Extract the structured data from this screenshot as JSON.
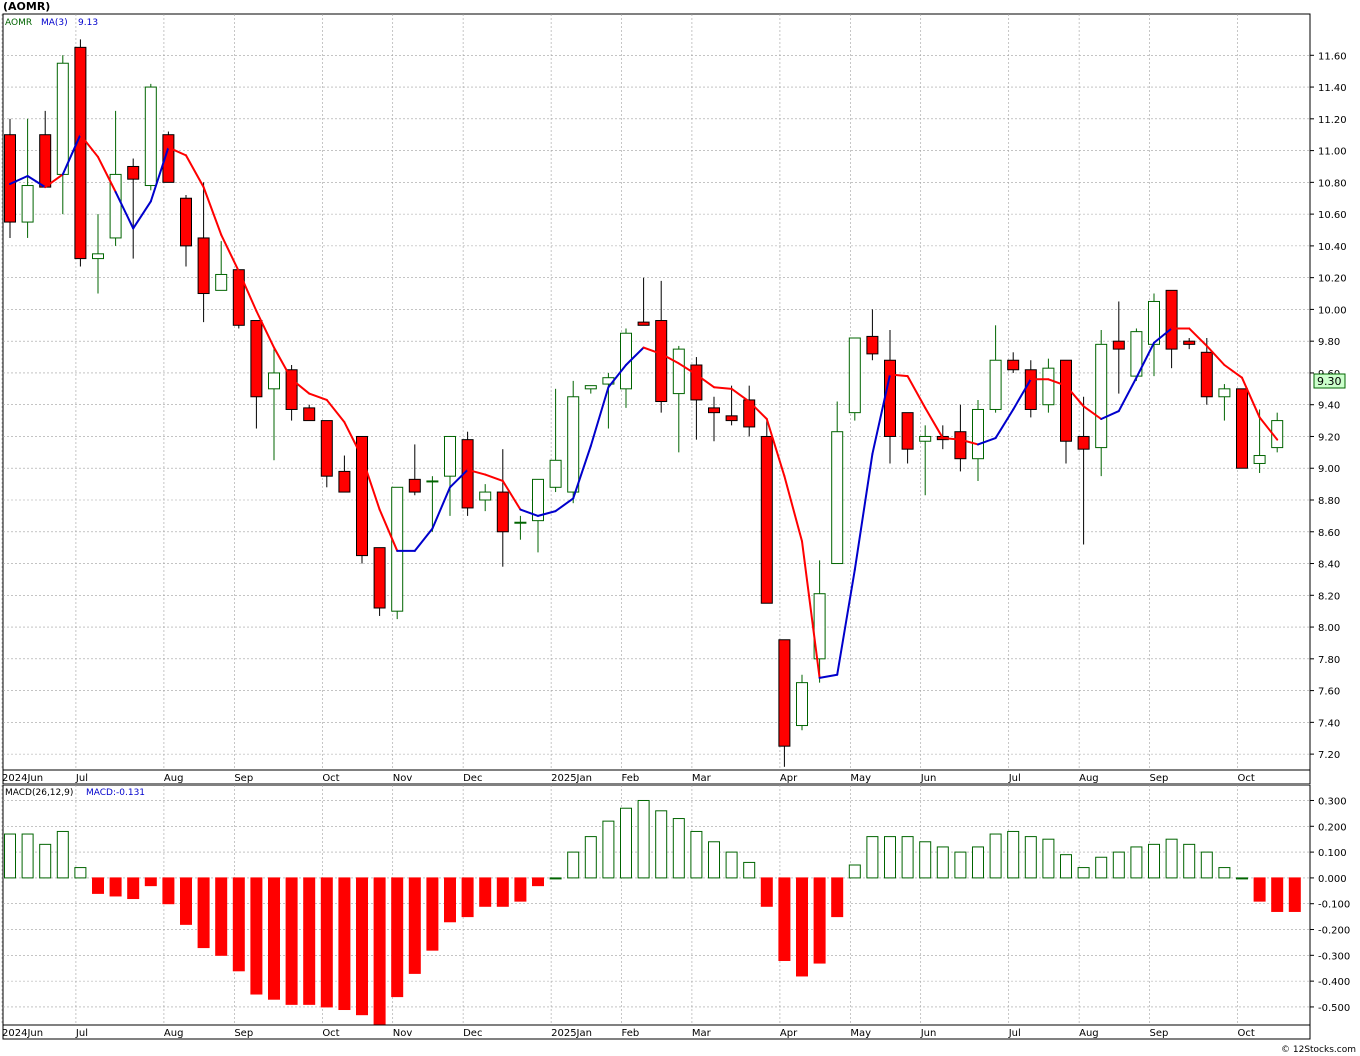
{
  "page": {
    "title": "(AOMR)",
    "footer": "© 12Stocks.com"
  },
  "chart_data": [
    {
      "type": "candlestick",
      "legend": {
        "symbol": "AOMR",
        "ma_label": "MA(3)",
        "ma_value": "9.13"
      },
      "last_price_label": "9.30",
      "ylim": [
        7.1,
        11.86
      ],
      "yticks": [
        7.2,
        7.4,
        7.6,
        7.8,
        8.0,
        8.2,
        8.4,
        8.6,
        8.8,
        9.0,
        9.2,
        9.4,
        9.6,
        9.8,
        10.0,
        10.2,
        10.4,
        10.6,
        10.8,
        11.0,
        11.2,
        11.4,
        11.6
      ],
      "month_labels": [
        {
          "label": "2024Jun",
          "week": 0
        },
        {
          "label": "Jul",
          "week": 4.2
        },
        {
          "label": "Aug",
          "week": 9.2
        },
        {
          "label": "Sep",
          "week": 13.2
        },
        {
          "label": "Oct",
          "week": 18.2
        },
        {
          "label": "Nov",
          "week": 22.2
        },
        {
          "label": "Dec",
          "week": 26.2
        },
        {
          "label": "2025Jan",
          "week": 31.2
        },
        {
          "label": "Feb",
          "week": 35.2
        },
        {
          "label": "Mar",
          "week": 39.2
        },
        {
          "label": "Apr",
          "week": 44.2
        },
        {
          "label": "May",
          "week": 48.2
        },
        {
          "label": "Jun",
          "week": 52.2
        },
        {
          "label": "Jul",
          "week": 57.2
        },
        {
          "label": "Aug",
          "week": 61.2
        },
        {
          "label": "Sep",
          "week": 65.2
        },
        {
          "label": "Oct",
          "week": 70.2
        }
      ],
      "candles": [
        [
          11.1,
          11.2,
          10.45,
          10.55
        ],
        [
          10.55,
          11.2,
          10.45,
          10.78
        ],
        [
          11.1,
          11.25,
          10.77,
          10.77
        ],
        [
          10.85,
          11.6,
          10.6,
          11.55
        ],
        [
          11.65,
          11.7,
          10.27,
          10.32
        ],
        [
          10.32,
          10.6,
          10.1,
          10.35
        ],
        [
          10.45,
          11.25,
          10.4,
          10.85
        ],
        [
          10.9,
          10.95,
          10.32,
          10.82
        ],
        [
          10.78,
          11.42,
          10.75,
          11.4
        ],
        [
          11.1,
          11.12,
          10.8,
          10.8
        ],
        [
          10.7,
          10.72,
          10.27,
          10.4
        ],
        [
          10.45,
          10.8,
          9.92,
          10.1
        ],
        [
          10.12,
          10.43,
          10.12,
          10.22
        ],
        [
          10.25,
          10.25,
          9.88,
          9.9
        ],
        [
          9.93,
          9.93,
          9.25,
          9.45
        ],
        [
          9.5,
          9.75,
          9.05,
          9.6
        ],
        [
          9.62,
          9.65,
          9.3,
          9.37
        ],
        [
          9.38,
          9.4,
          9.3,
          9.3
        ],
        [
          9.3,
          9.3,
          8.88,
          8.95
        ],
        [
          8.98,
          9.08,
          8.85,
          8.85
        ],
        [
          9.2,
          9.2,
          8.4,
          8.45
        ],
        [
          8.5,
          8.5,
          8.07,
          8.12
        ],
        [
          8.1,
          8.88,
          8.05,
          8.88
        ],
        [
          8.93,
          9.15,
          8.83,
          8.85
        ],
        [
          8.92,
          8.95,
          8.6,
          8.92
        ],
        [
          8.95,
          9.2,
          8.7,
          9.2
        ],
        [
          9.18,
          9.23,
          8.7,
          8.75
        ],
        [
          8.8,
          8.9,
          8.73,
          8.85
        ],
        [
          8.85,
          9.12,
          8.38,
          8.6
        ],
        [
          8.66,
          8.7,
          8.55,
          8.66
        ],
        [
          8.67,
          8.93,
          8.47,
          8.93
        ],
        [
          8.88,
          9.5,
          8.85,
          9.05
        ],
        [
          8.85,
          9.55,
          8.78,
          9.45
        ],
        [
          9.5,
          9.52,
          9.47,
          9.52
        ],
        [
          9.53,
          9.6,
          9.25,
          9.57
        ],
        [
          9.5,
          9.88,
          9.38,
          9.85
        ],
        [
          9.92,
          10.2,
          9.9,
          9.9
        ],
        [
          9.93,
          10.18,
          9.35,
          9.42
        ],
        [
          9.47,
          9.77,
          9.1,
          9.75
        ],
        [
          9.65,
          9.7,
          9.18,
          9.43
        ],
        [
          9.38,
          9.45,
          9.17,
          9.35
        ],
        [
          9.33,
          9.52,
          9.27,
          9.3
        ],
        [
          9.43,
          9.52,
          9.2,
          9.26
        ],
        [
          9.2,
          9.3,
          8.15,
          8.15
        ],
        [
          7.92,
          7.92,
          7.12,
          7.25
        ],
        [
          7.38,
          7.7,
          7.35,
          7.65
        ],
        [
          7.8,
          8.42,
          7.65,
          8.21
        ],
        [
          8.4,
          9.42,
          8.4,
          9.23
        ],
        [
          9.35,
          9.82,
          9.3,
          9.82
        ],
        [
          9.83,
          10.0,
          9.68,
          9.72
        ],
        [
          9.68,
          9.87,
          9.03,
          9.2
        ],
        [
          9.35,
          9.35,
          9.03,
          9.12
        ],
        [
          9.17,
          9.27,
          8.83,
          9.2
        ],
        [
          9.2,
          9.27,
          9.12,
          9.18
        ],
        [
          9.23,
          9.4,
          8.98,
          9.06
        ],
        [
          9.06,
          9.43,
          8.92,
          9.37
        ],
        [
          9.37,
          9.9,
          9.35,
          9.68
        ],
        [
          9.68,
          9.73,
          9.6,
          9.62
        ],
        [
          9.62,
          9.68,
          9.32,
          9.37
        ],
        [
          9.4,
          9.69,
          9.35,
          9.63
        ],
        [
          9.68,
          9.68,
          9.03,
          9.17
        ],
        [
          9.2,
          9.45,
          8.52,
          9.12
        ],
        [
          9.13,
          9.87,
          8.95,
          9.78
        ],
        [
          9.8,
          10.05,
          9.47,
          9.75
        ],
        [
          9.58,
          9.88,
          9.55,
          9.86
        ],
        [
          9.78,
          10.1,
          9.58,
          10.05
        ],
        [
          10.12,
          10.12,
          9.63,
          9.75
        ],
        [
          9.8,
          9.82,
          9.75,
          9.78
        ],
        [
          9.73,
          9.82,
          9.4,
          9.45
        ],
        [
          9.45,
          9.53,
          9.3,
          9.5
        ],
        [
          9.5,
          9.5,
          9.0,
          9.0
        ],
        [
          9.03,
          9.37,
          8.97,
          9.08
        ],
        [
          9.13,
          9.35,
          9.1,
          9.3
        ]
      ],
      "ma": [
        10.79,
        10.84,
        10.77,
        10.85,
        11.1,
        10.96,
        10.74,
        10.51,
        10.68,
        11.02,
        10.97,
        10.77,
        10.47,
        10.24,
        9.99,
        9.76,
        9.56,
        9.47,
        9.43,
        9.29,
        9.07,
        8.74,
        8.48,
        8.48,
        8.62,
        8.88,
        8.99,
        8.96,
        8.92,
        8.74,
        8.7,
        8.73,
        8.81,
        9.14,
        9.51,
        9.65,
        9.76,
        9.72,
        9.66,
        9.59,
        9.51,
        9.5,
        9.42,
        9.31,
        8.95,
        8.54,
        7.68,
        7.7,
        8.36,
        9.09,
        9.59,
        9.58,
        9.38,
        9.19,
        9.18,
        9.15,
        9.19,
        9.37,
        9.56,
        9.56,
        9.52,
        9.39,
        9.31,
        9.36,
        9.57,
        9.79,
        9.88,
        9.88,
        9.77,
        9.65,
        9.57,
        9.32,
        9.18
      ],
      "ma_colors": [
        "#ff0000",
        "#0000cc",
        "#0000cc",
        "#ff0000",
        "#0000cc",
        "#ff0000",
        "#ff0000",
        "#0000cc",
        "#0000cc",
        "#0000cc",
        "#ff0000",
        "#ff0000",
        "#ff0000",
        "#ff0000",
        "#ff0000",
        "#ff0000",
        "#ff0000",
        "#ff0000",
        "#ff0000",
        "#ff0000",
        "#ff0000",
        "#ff0000",
        "#ff0000",
        "#0000cc",
        "#0000cc",
        "#0000cc",
        "#0000cc",
        "#ff0000",
        "#ff0000",
        "#ff0000",
        "#0000cc",
        "#0000cc",
        "#0000cc",
        "#0000cc",
        "#0000cc",
        "#0000cc",
        "#0000cc",
        "#ff0000",
        "#ff0000",
        "#ff0000",
        "#ff0000",
        "#ff0000",
        "#ff0000",
        "#ff0000",
        "#ff0000",
        "#ff0000",
        "#ff0000",
        "#0000cc",
        "#0000cc",
        "#0000cc",
        "#0000cc",
        "#ff0000",
        "#ff0000",
        "#ff0000",
        "#ff0000",
        "#ff0000",
        "#0000cc",
        "#0000cc",
        "#0000cc",
        "#ff0000",
        "#ff0000",
        "#ff0000",
        "#ff0000",
        "#0000cc",
        "#0000cc",
        "#0000cc",
        "#0000cc",
        "#ff0000",
        "#ff0000",
        "#ff0000",
        "#ff0000",
        "#ff0000",
        "#ff0000"
      ]
    },
    {
      "type": "bar",
      "legend": {
        "label": "MACD(26,12,9)",
        "value_label": "MACD:-0.131"
      },
      "ylim": [
        -0.57,
        0.36
      ],
      "yticks": [
        0.3,
        0.2,
        0.1,
        0.0,
        -0.1,
        -0.2,
        -0.3,
        -0.4,
        -0.5
      ],
      "ytick_labels": [
        "0.300",
        "0.200",
        "0.100",
        "0.000",
        "-0.100",
        "-0.200",
        "-0.300",
        "-0.400",
        "-0.500"
      ],
      "values": [
        0.17,
        0.17,
        0.13,
        0.18,
        0.04,
        -0.06,
        -0.07,
        -0.08,
        -0.03,
        -0.1,
        -0.18,
        -0.27,
        -0.3,
        -0.36,
        -0.45,
        -0.47,
        -0.49,
        -0.49,
        -0.5,
        -0.51,
        -0.53,
        -0.57,
        -0.46,
        -0.37,
        -0.28,
        -0.17,
        -0.15,
        -0.11,
        -0.11,
        -0.09,
        -0.03,
        0.0,
        0.1,
        0.16,
        0.22,
        0.27,
        0.3,
        0.26,
        0.23,
        0.18,
        0.14,
        0.1,
        0.06,
        -0.11,
        -0.32,
        -0.38,
        -0.33,
        -0.15,
        0.05,
        0.16,
        0.16,
        0.16,
        0.14,
        0.12,
        0.1,
        0.12,
        0.17,
        0.18,
        0.16,
        0.15,
        0.09,
        0.04,
        0.08,
        0.1,
        0.12,
        0.13,
        0.15,
        0.13,
        0.1,
        0.04,
        0.0,
        -0.09,
        -0.13,
        -0.13
      ],
      "colors": {
        "positive": "#006400",
        "negative": "#ff0000"
      }
    }
  ],
  "colors": {
    "up_candle": "#006400",
    "down_candle": "#ff0000",
    "ma_up": "#0000cc",
    "ma_down": "#ff0000",
    "grid": "#a0a0a0",
    "last_price_bg": "#ccffcc"
  }
}
